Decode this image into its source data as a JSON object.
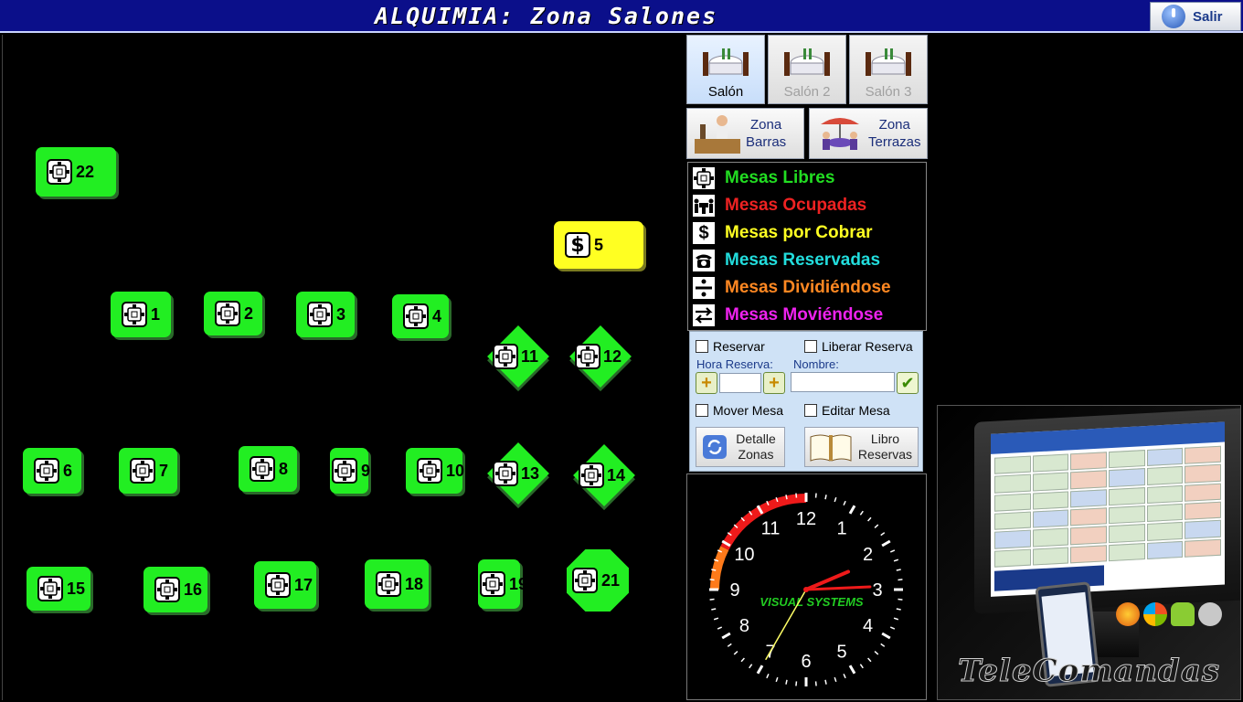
{
  "window": {
    "title": "ALQUIMIA: Zona Salones",
    "exit_label": "Salir"
  },
  "salones": [
    {
      "label": "Salón",
      "state": "active"
    },
    {
      "label": "Salón 2",
      "state": "disabled"
    },
    {
      "label": "Salón 3",
      "state": "disabled"
    }
  ],
  "zonas": [
    {
      "label": "Zona\nBarras"
    },
    {
      "label": "Zona\nTerrazas"
    }
  ],
  "tables": [
    {
      "num": "22",
      "status": "libre"
    },
    {
      "num": "5",
      "status": "por_cobrar"
    },
    {
      "num": "1",
      "status": "libre"
    },
    {
      "num": "2",
      "status": "libre"
    },
    {
      "num": "3",
      "status": "libre"
    },
    {
      "num": "4",
      "status": "libre"
    },
    {
      "num": "11",
      "status": "libre"
    },
    {
      "num": "12",
      "status": "libre"
    },
    {
      "num": "6",
      "status": "libre"
    },
    {
      "num": "7",
      "status": "libre"
    },
    {
      "num": "8",
      "status": "libre"
    },
    {
      "num": "9",
      "status": "libre"
    },
    {
      "num": "10",
      "status": "libre"
    },
    {
      "num": "13",
      "status": "libre"
    },
    {
      "num": "14",
      "status": "libre"
    },
    {
      "num": "15",
      "status": "libre"
    },
    {
      "num": "16",
      "status": "libre"
    },
    {
      "num": "17",
      "status": "libre"
    },
    {
      "num": "18",
      "status": "libre"
    },
    {
      "num": "19",
      "status": "libre"
    },
    {
      "num": "21",
      "status": "libre"
    }
  ],
  "legend": [
    {
      "label": "Mesas Libres",
      "color": "#22dd22",
      "icon": "table-free-icon"
    },
    {
      "label": "Mesas Ocupadas",
      "color": "#ee2222",
      "icon": "table-occupied-icon"
    },
    {
      "label": "Mesas por Cobrar",
      "color": "#ffff22",
      "icon": "dollar-icon"
    },
    {
      "label": "Mesas Reservadas",
      "color": "#22dddd",
      "icon": "phone-icon"
    },
    {
      "label": "Mesas Dividiéndose",
      "color": "#ff8822",
      "icon": "divide-icon"
    },
    {
      "label": "Mesas Moviéndose",
      "color": "#ee22ee",
      "icon": "move-arrows-icon"
    }
  ],
  "reserva": {
    "reservar": "Reservar",
    "liberar": "Liberar Reserva",
    "hora_label": "Hora Reserva:",
    "nombre_label": "Nombre:",
    "mover": "Mover Mesa",
    "editar": "Editar Mesa",
    "detalle": "Detalle\nZonas",
    "libro": "Libro\nReservas"
  },
  "clock": {
    "numbers": [
      "12",
      "1",
      "2",
      "3",
      "4",
      "5",
      "6",
      "7",
      "8",
      "9",
      "10",
      "11"
    ],
    "time": "02:14:35",
    "brand": "VISUAL SYSTEMS"
  },
  "promo": {
    "brand": "TeleComandas"
  }
}
